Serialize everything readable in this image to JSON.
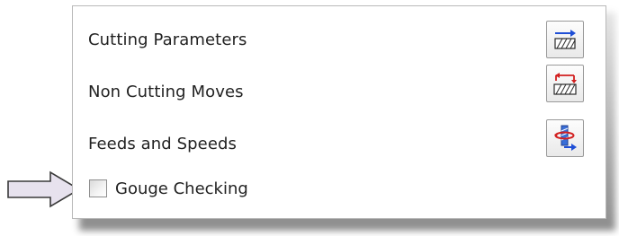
{
  "options": {
    "rows": [
      {
        "label": "Cutting Parameters",
        "icon": "cutting-parameters-icon"
      },
      {
        "label": "Non Cutting Moves",
        "icon": "non-cutting-moves-icon"
      },
      {
        "label": "Feeds and Speeds",
        "icon": "feeds-and-speeds-icon"
      }
    ],
    "gouge": {
      "label": "Gouge Checking",
      "checked": false
    }
  },
  "colors": {
    "accent_blue": "#1f4fd6",
    "accent_red": "#d21f1f",
    "pointer_fill": "#e7e2ee"
  }
}
